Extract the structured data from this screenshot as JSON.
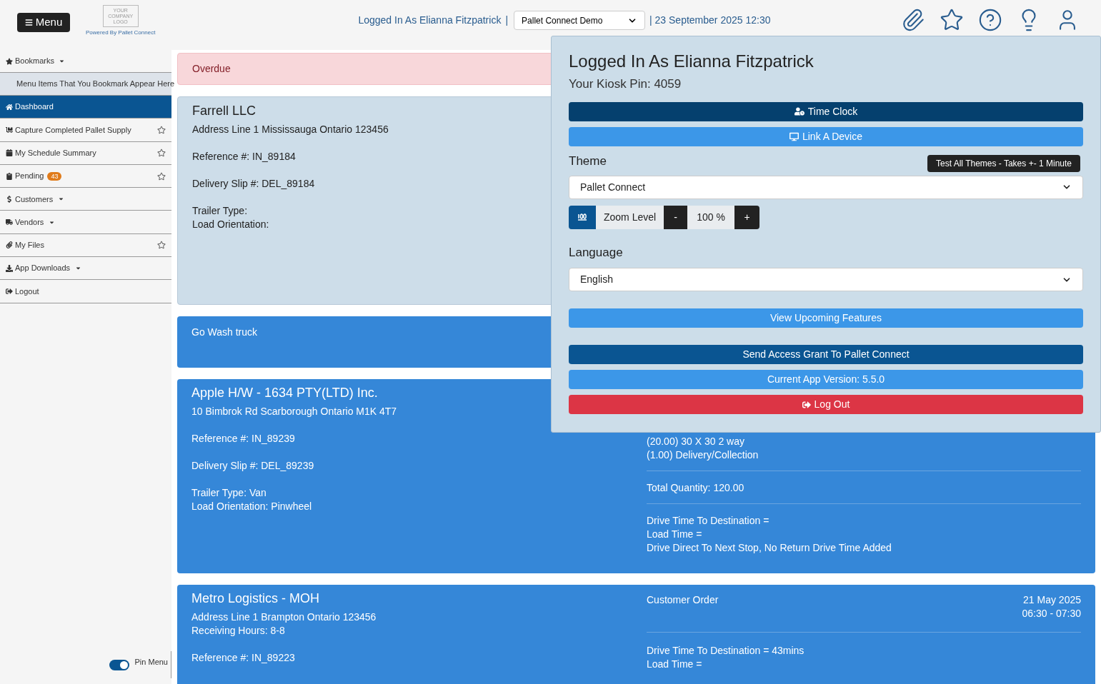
{
  "header": {
    "menu_button": "Menu",
    "logo_lines": [
      "YOUR",
      "COMPANY",
      "LOGO"
    ],
    "powered_by": "Powered By Pallet Connect",
    "logged_in": "Logged In As Elianna Fitzpatrick",
    "separator": "|",
    "company_select": "Pallet Connect Demo",
    "datetime": "| 23 September 2025 12:30"
  },
  "sidebar": {
    "bookmarks": "Bookmarks",
    "bookmark_hint": "Menu Items That You Bookmark Appear Here",
    "items": [
      {
        "label": "Dashboard",
        "selected": true,
        "dropdown": false,
        "bookmarkable": false
      },
      {
        "label": "Capture Completed Pallet Supply",
        "selected": false,
        "dropdown": false,
        "bookmarkable": true
      },
      {
        "label": "My Schedule Summary",
        "selected": false,
        "dropdown": false,
        "bookmarkable": true
      },
      {
        "label": "Pending",
        "badge": "43",
        "selected": false,
        "dropdown": false,
        "bookmarkable": true
      },
      {
        "label": "Customers",
        "selected": false,
        "dropdown": true,
        "bookmarkable": false
      },
      {
        "label": "Vendors",
        "selected": false,
        "dropdown": true,
        "bookmarkable": false
      },
      {
        "label": "My Files",
        "selected": false,
        "dropdown": false,
        "bookmarkable": true
      },
      {
        "label": "App Downloads",
        "selected": false,
        "dropdown": true,
        "bookmarkable": false
      },
      {
        "label": "Logout",
        "selected": false,
        "dropdown": false,
        "bookmarkable": false
      }
    ],
    "pin_menu": {
      "label": "Pin Menu",
      "on": true
    }
  },
  "cards": [
    {
      "kind": "alert",
      "text": "Overdue"
    },
    {
      "kind": "job",
      "color": "#cddde9",
      "title": "Farrell LLC",
      "left": [
        [
          "Address Line 1 Mississauga Ontario 123456"
        ],
        [
          "Reference #: IN_89184"
        ],
        [
          "Delivery Slip #: DEL_89184"
        ],
        [
          "Trailer Type:",
          "Load Orientation:"
        ]
      ]
    },
    {
      "kind": "note",
      "color": "#3587d8",
      "text": "Go Wash truck"
    },
    {
      "kind": "job",
      "color": "#3587d8",
      "title": "Apple H/W - 1634 PTY(LTD) Inc.",
      "left": [
        [
          "10 Bimbrok Rd Scarborough Ontario M1K 4T7"
        ],
        [
          "Reference #: IN_89239"
        ],
        [
          "Delivery Slip #: DEL_89239"
        ],
        [
          "Trailer Type: Van",
          "Load Orientation: Pinwheel"
        ]
      ],
      "right": [
        [
          "(20.00) 30 X 30 2 way",
          "(1.00) Delivery/Collection"
        ],
        [
          "Total Quantity: 120.00"
        ],
        [
          "Drive Time To Destination =",
          "Load Time =",
          "Drive Direct To Next Stop, No Return Drive Time Added"
        ]
      ]
    },
    {
      "kind": "job",
      "color": "#3587d8",
      "title": "Metro Logistics - MOH",
      "left": [
        [
          "Address Line 1 Brampton Ontario 123456",
          "Receiving Hours: 8-8"
        ],
        [
          "Reference #: IN_89223"
        ]
      ],
      "order_type": "Customer Order",
      "date_lines": [
        "21 May 2025",
        "06:30 - 07:30"
      ],
      "right": [
        [
          "Drive Time To Destination = 43mins",
          "Load Time ="
        ]
      ]
    }
  ],
  "account_panel": {
    "title": "Logged In As Elianna Fitzpatrick",
    "kiosk_pin": "Your Kiosk Pin: 4059",
    "top_buttons": [
      {
        "label": "Time Clock",
        "kind": "dark"
      },
      {
        "label": "Link A Device",
        "kind": "primary"
      }
    ],
    "theme_label": "Theme",
    "test_themes_button": "Test All Themes - Takes +- 1 Minute",
    "theme_select": "Pallet Connect",
    "zoom": {
      "label": "Zoom Level",
      "minus": "-",
      "value": "100 %",
      "plus": "+"
    },
    "language_label": "Language",
    "language_select": "English",
    "button_groups": [
      [
        {
          "label": "View Upcoming Features",
          "kind": "primary"
        }
      ],
      [
        {
          "label": "Send Access Grant To Pallet Connect",
          "kind": "navy"
        },
        {
          "label": "Current App Version: 5.5.0",
          "kind": "primary"
        },
        {
          "label": "Log Out",
          "kind": "danger"
        }
      ]
    ]
  }
}
